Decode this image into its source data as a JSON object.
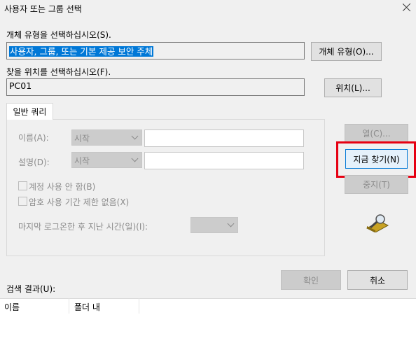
{
  "window": {
    "title": "사용자 또는 그룹 선택"
  },
  "object_type": {
    "label": "개체 유형을 선택하십시오(S).",
    "value": "사용자, 그룹, 또는 기본 제공 보안 주체",
    "button": "개체 유형(O)..."
  },
  "location": {
    "label": "찾을 위치를 선택하십시오(F).",
    "value": "PC01",
    "button": "위치(L)..."
  },
  "tab": {
    "label": "일반 쿼리"
  },
  "query": {
    "name_label": "이름(A):",
    "name_mode": "시작",
    "name_value": "",
    "desc_label": "설명(D):",
    "desc_mode": "시작",
    "desc_value": "",
    "disabled_accounts_label": "계정 사용 안 함(B)",
    "non_expiring_pw_label": "암호 사용 기간 제한 없음(X)",
    "days_since_logon_label": "마지막 로그온한 후 지난 시간(일)(I):",
    "days_since_logon_value": ""
  },
  "side_buttons": {
    "columns": "열(C)...",
    "find_now": "지금 찾기(N)",
    "stop": "중지(T)"
  },
  "icons": {
    "search_glass": "magnifier-icon",
    "close": "close-icon"
  },
  "footer": {
    "ok": "확인",
    "cancel": "취소",
    "results_label": "검색 결과(U):"
  },
  "results_table": {
    "columns": [
      "이름",
      "폴더 내"
    ],
    "rows": []
  },
  "colors": {
    "selection": "#0078d7",
    "highlight_box": "#e60012",
    "dialog_bg": "#f0f0f0"
  }
}
